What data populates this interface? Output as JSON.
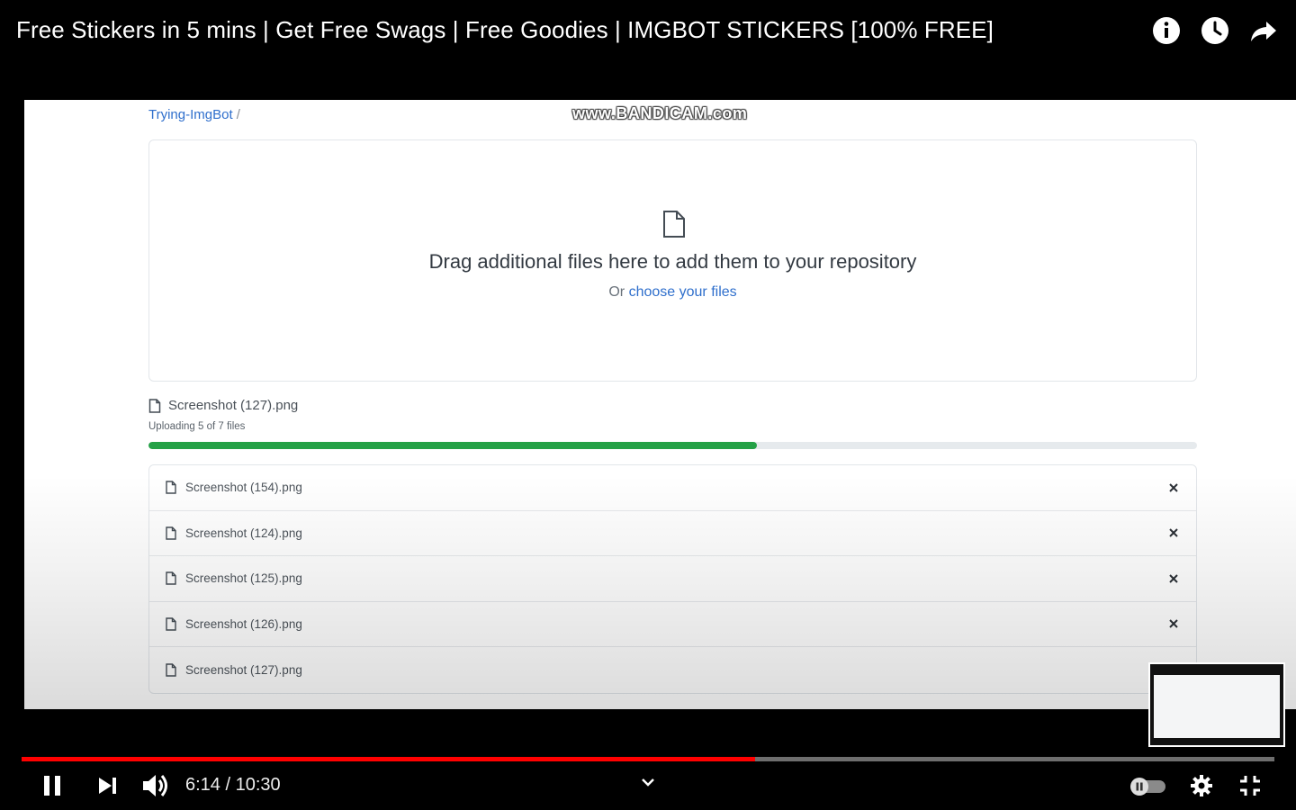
{
  "video": {
    "title": "Free Stickers in 5 mins | Get Free Swags | Free Goodies | IMGBOT STICKERS [100% FREE]",
    "current_time": "6:14",
    "duration": "10:30",
    "time_display": "6:14 / 10:30",
    "progress_fraction": 0.5857
  },
  "top_actions": [
    {
      "icon": "info-icon"
    },
    {
      "icon": "watch-later-icon"
    },
    {
      "icon": "share-icon"
    }
  ],
  "page": {
    "breadcrumb_link": "Trying-ImgBot",
    "breadcrumb_sep": " /",
    "watermark": "www.BANDICAM.com",
    "dropzone": {
      "title": "Drag additional files here to add them to your repository",
      "or_text": "Or ",
      "choose_link": "choose your files"
    },
    "current_upload": {
      "file_name": "Screenshot (127).png",
      "status": "Uploading 5 of 7 files",
      "progress_fraction": 0.58
    },
    "files": [
      {
        "name": "Screenshot (154).png"
      },
      {
        "name": "Screenshot (124).png"
      },
      {
        "name": "Screenshot (125).png"
      },
      {
        "name": "Screenshot (126).png"
      },
      {
        "name": "Screenshot (127).png"
      }
    ]
  },
  "colors": {
    "accent_red": "#ff0000",
    "link_blue": "#2f6fcc",
    "progress_green": "#24a146"
  }
}
